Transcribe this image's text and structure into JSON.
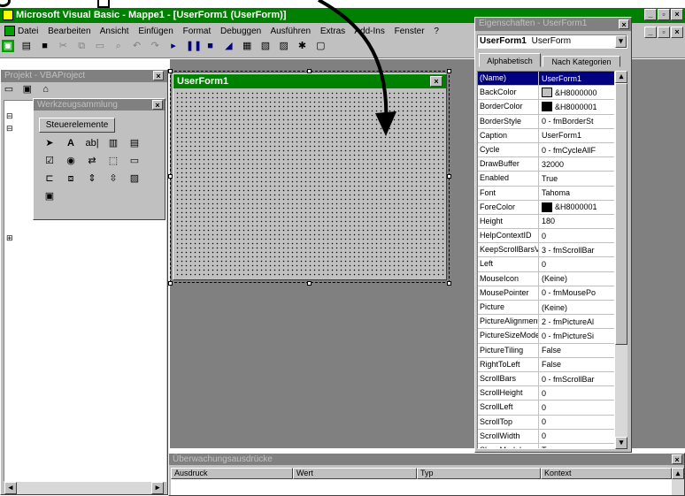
{
  "app_title": "Microsoft Visual Basic - Mappe1 - [UserForm1 (UserForm)]",
  "menu": [
    "Datei",
    "Bearbeiten",
    "Ansicht",
    "Einfügen",
    "Format",
    "Debuggen",
    "Ausführen",
    "Extras",
    "Add-Ins",
    "Fenster",
    "?"
  ],
  "project_panel_title": "Projekt - VBAProject",
  "toolbox_title": "Werkzeugsammlung",
  "toolbox_tab": "Steuerelemente",
  "userform_caption": "UserForm1",
  "properties": {
    "title": "Eigenschaften - UserForm1",
    "object_name": "UserForm1",
    "object_type": "UserForm",
    "tab_alpha": "Alphabetisch",
    "tab_cat": "Nach Kategorien",
    "rows": [
      {
        "n": "(Name)",
        "v": "UserForm1"
      },
      {
        "n": "BackColor",
        "v": "&H8000000",
        "sw": "#c0c0c0"
      },
      {
        "n": "BorderColor",
        "v": "&H8000001",
        "sw": "#000000"
      },
      {
        "n": "BorderStyle",
        "v": "0 - fmBorderSt"
      },
      {
        "n": "Caption",
        "v": "UserForm1"
      },
      {
        "n": "Cycle",
        "v": "0 - fmCycleAllF"
      },
      {
        "n": "DrawBuffer",
        "v": "32000"
      },
      {
        "n": "Enabled",
        "v": "True"
      },
      {
        "n": "Font",
        "v": "Tahoma"
      },
      {
        "n": "ForeColor",
        "v": "&H8000001",
        "sw": "#000000"
      },
      {
        "n": "Height",
        "v": "180"
      },
      {
        "n": "HelpContextID",
        "v": "0"
      },
      {
        "n": "KeepScrollBarsVi",
        "v": "3 - fmScrollBar"
      },
      {
        "n": "Left",
        "v": "0"
      },
      {
        "n": "MouseIcon",
        "v": "(Keine)"
      },
      {
        "n": "MousePointer",
        "v": "0 - fmMousePo"
      },
      {
        "n": "Picture",
        "v": "(Keine)"
      },
      {
        "n": "PictureAlignment",
        "v": "2 - fmPictureAl"
      },
      {
        "n": "PictureSizeMode",
        "v": "0 - fmPictureSi"
      },
      {
        "n": "PictureTiling",
        "v": "False"
      },
      {
        "n": "RightToLeft",
        "v": "False"
      },
      {
        "n": "ScrollBars",
        "v": "0 - fmScrollBar"
      },
      {
        "n": "ScrollHeight",
        "v": "0"
      },
      {
        "n": "ScrollLeft",
        "v": "0"
      },
      {
        "n": "ScrollTop",
        "v": "0"
      },
      {
        "n": "ScrollWidth",
        "v": "0"
      },
      {
        "n": "ShowModal",
        "v": "True"
      }
    ]
  },
  "watch": {
    "title": "Überwachungsausdrücke",
    "cols": [
      "Ausdruck",
      "Wert",
      "Typ",
      "Kontext"
    ]
  },
  "colors": {
    "titlebar": "#008000",
    "face": "#c0c0c0",
    "selection": "#000080"
  }
}
